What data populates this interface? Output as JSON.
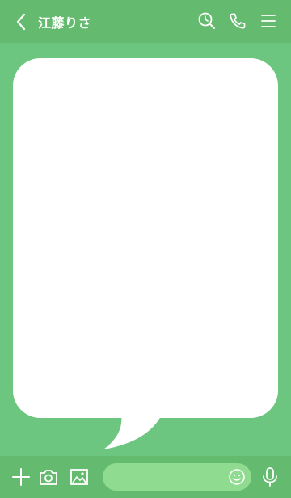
{
  "header": {
    "title": "江藤りさ",
    "icons": [
      "back-chevron-icon",
      "search-clock-icon",
      "phone-icon",
      "menu-icon"
    ]
  },
  "chat": {
    "bubble_text": ""
  },
  "bottom_bar": {
    "icons": [
      "plus-icon",
      "camera-icon",
      "image-icon",
      "emoji-icon",
      "microphone-icon"
    ],
    "message_input": {
      "value": "",
      "placeholder": ""
    }
  },
  "colors": {
    "header_bg": "#64bb6f",
    "chat_bg": "#6dc67f",
    "bubble": "#ffffff",
    "input_bg": "#8fdb90",
    "icon": "#ffffff"
  }
}
